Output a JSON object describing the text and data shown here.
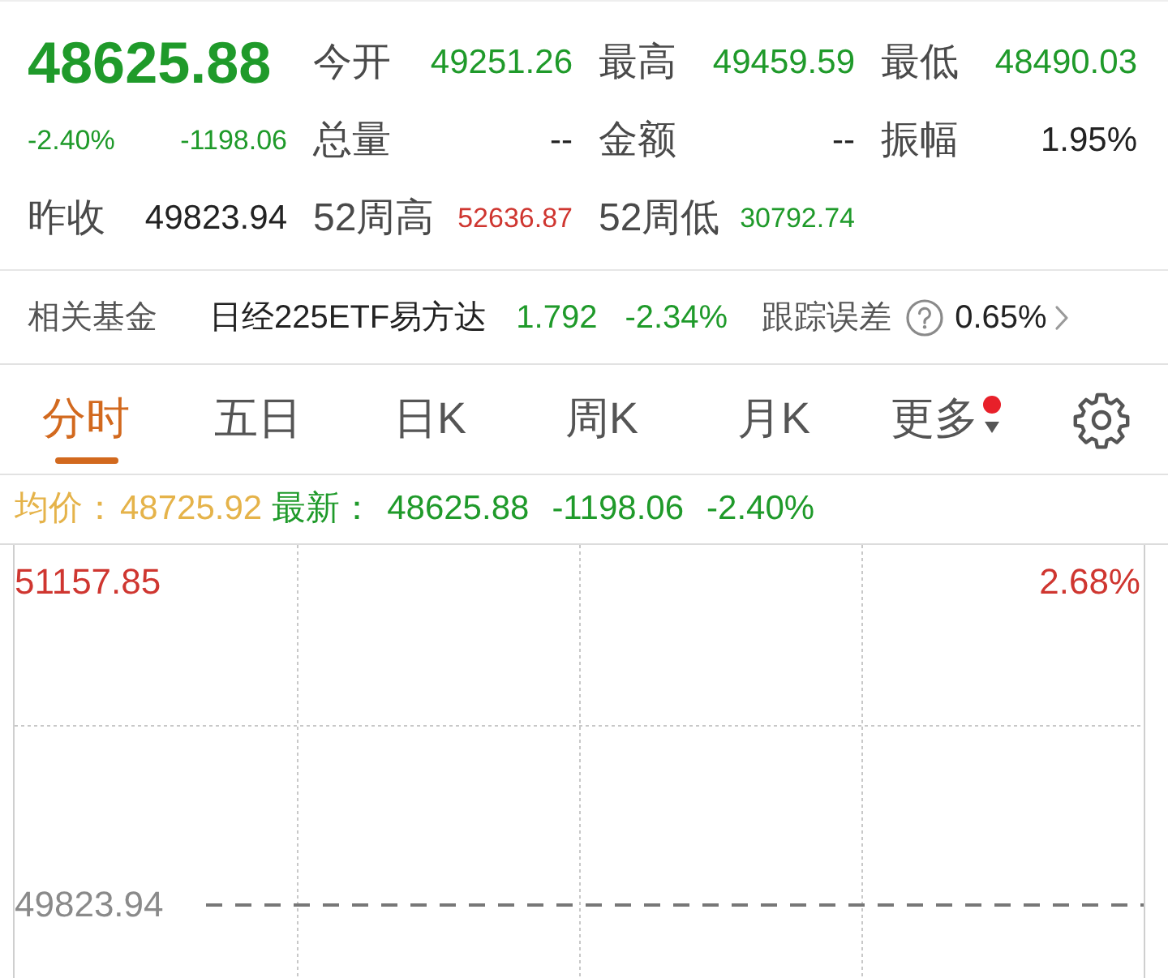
{
  "quote": {
    "price": "48625.88",
    "change_pct": "-2.40%",
    "change": "-1198.06",
    "color": "#1f9a2a",
    "prev_close_label": "昨收",
    "prev_close": "49823.94"
  },
  "stats": [
    [
      {
        "label": "今开",
        "value": "49251.26",
        "color": "#1f9a2a",
        "kind": "main"
      },
      {
        "label": "最高",
        "value": "49459.59",
        "color": "#1f9a2a",
        "kind": "main"
      },
      {
        "label": "最低",
        "value": "48490.03",
        "color": "#1f9a2a",
        "kind": "main"
      }
    ],
    [
      {
        "label": "总量",
        "value": "--",
        "color": "#222222",
        "kind": "main"
      },
      {
        "label": "金额",
        "value": "--",
        "color": "#222222",
        "kind": "main"
      },
      {
        "label": "振幅",
        "value": "1.95%",
        "color": "#222222",
        "kind": "main"
      }
    ],
    [
      {
        "label": "52周高",
        "value": "52636.87",
        "color": "#cf3630",
        "kind": "range"
      },
      {
        "label": "52周低",
        "value": "30792.74",
        "color": "#1f9a2a",
        "kind": "range"
      }
    ]
  ],
  "fund": {
    "label": "相关基金",
    "name": "日经225ETF易方达",
    "price": "1.792",
    "change_pct": "-2.34%",
    "color": "#1f9a2a",
    "tracking_label": "跟踪误差",
    "tracking_error": "0.65%"
  },
  "tabs": [
    {
      "label": "分时",
      "selected": true,
      "kind": "period",
      "notice": false
    },
    {
      "label": "五日",
      "selected": false,
      "kind": "period",
      "notice": false
    },
    {
      "label": "日K",
      "selected": false,
      "kind": "period",
      "notice": false
    },
    {
      "label": "周K",
      "selected": false,
      "kind": "period",
      "notice": false
    },
    {
      "label": "月K",
      "selected": false,
      "kind": "period",
      "notice": false
    },
    {
      "label": "更多",
      "selected": false,
      "kind": "menu",
      "notice": true
    }
  ],
  "latest": {
    "avg_label": "均价：",
    "avg": "48725.92",
    "last_label": "最新：",
    "last": "48625.88",
    "change": "-1198.06",
    "change_pct": "-2.40%",
    "color": "#1f9a2a"
  },
  "chart": {
    "high_label": "51157.85",
    "high_pct": "2.68%",
    "prev_close_label": "49823.94"
  }
}
